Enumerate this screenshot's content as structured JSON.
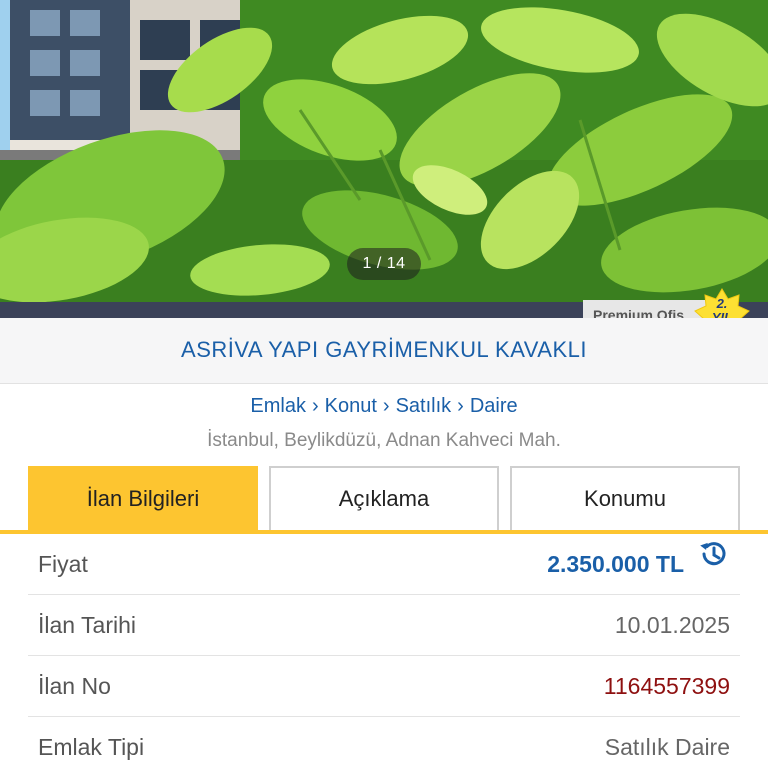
{
  "photo": {
    "counter": "1 / 14"
  },
  "badge": {
    "premium_label": "Premium Ofis",
    "years_label": "2.",
    "years_unit": "YIL"
  },
  "office": {
    "name": "ASRİVA YAPI GAYRİMENKUL KAVAKLI"
  },
  "breadcrumb": {
    "items": [
      "Emlak",
      "Konut",
      "Satılık",
      "Daire"
    ],
    "separator": "›"
  },
  "location": "İstanbul, Beylikdüzü, Adnan Kahveci Mah.",
  "tabs": [
    {
      "label": "İlan Bilgileri",
      "active": true
    },
    {
      "label": "Açıklama",
      "active": false
    },
    {
      "label": "Konumu",
      "active": false
    }
  ],
  "details": {
    "price": {
      "key": "Fiyat",
      "value": "2.350.000 TL"
    },
    "date": {
      "key": "İlan Tarihi",
      "value": "10.01.2025"
    },
    "listing_no": {
      "key": "İlan No",
      "value": "1164557399"
    },
    "type": {
      "key": "Emlak Tipi",
      "value": "Satılık Daire"
    }
  },
  "colors": {
    "accent_blue": "#1a5fa8",
    "tab_yellow": "#fdc530",
    "listing_no_red": "#8e1010",
    "dark_band": "#3b4259"
  }
}
